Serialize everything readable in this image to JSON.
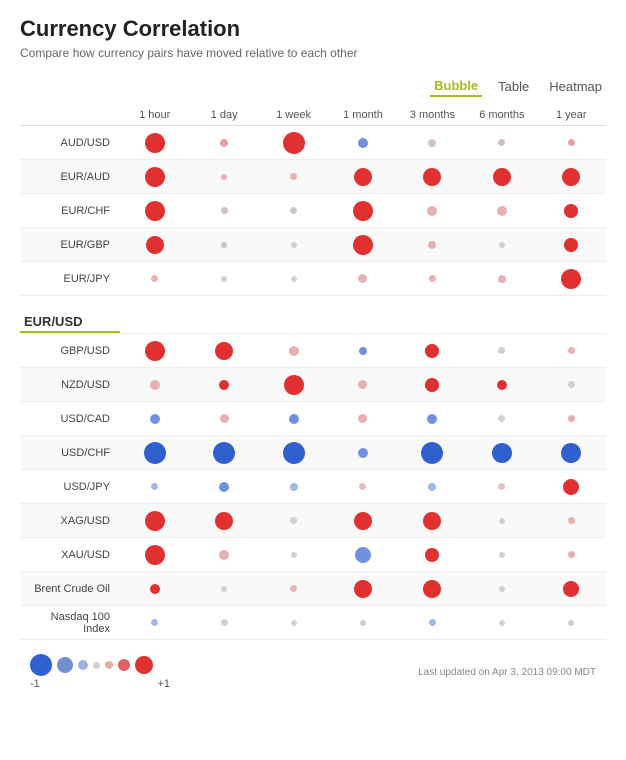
{
  "title": "Currency Correlation",
  "subtitle": "Compare how currency pairs have moved relative to each other",
  "viewToggle": {
    "options": [
      "Bubble",
      "Table",
      "Heatmap"
    ],
    "active": "Bubble"
  },
  "columns": [
    "1 hour",
    "1 day",
    "1 week",
    "1 month",
    "3 months",
    "6 months",
    "1 year"
  ],
  "rows": [
    {
      "pair": "AUD/USD",
      "highlighted": false,
      "separator": false,
      "values": [
        {
          "size": 20,
          "color": "#e03030"
        },
        {
          "size": 8,
          "color": "#e8a0a0"
        },
        {
          "size": 22,
          "color": "#e03030"
        },
        {
          "size": 10,
          "color": "#7090e0"
        },
        {
          "size": 8,
          "color": "#d0c0c0"
        },
        {
          "size": 7,
          "color": "#d0c0c0"
        },
        {
          "size": 7,
          "color": "#e8a0a0"
        }
      ]
    },
    {
      "pair": "EUR/AUD",
      "highlighted": false,
      "separator": false,
      "values": [
        {
          "size": 20,
          "color": "#e03030"
        },
        {
          "size": 6,
          "color": "#e8b0b0"
        },
        {
          "size": 7,
          "color": "#e8b0b0"
        },
        {
          "size": 18,
          "color": "#e03030"
        },
        {
          "size": 18,
          "color": "#e03030"
        },
        {
          "size": 18,
          "color": "#e03030"
        },
        {
          "size": 18,
          "color": "#e03030"
        }
      ]
    },
    {
      "pair": "EUR/CHF",
      "highlighted": false,
      "separator": false,
      "values": [
        {
          "size": 20,
          "color": "#e03030"
        },
        {
          "size": 7,
          "color": "#d0c0c0"
        },
        {
          "size": 7,
          "color": "#c8c8c8"
        },
        {
          "size": 20,
          "color": "#e03030"
        },
        {
          "size": 10,
          "color": "#e8b0b0"
        },
        {
          "size": 10,
          "color": "#e8b0b0"
        },
        {
          "size": 14,
          "color": "#e03030"
        }
      ]
    },
    {
      "pair": "EUR/GBP",
      "highlighted": false,
      "separator": false,
      "values": [
        {
          "size": 18,
          "color": "#e03030"
        },
        {
          "size": 6,
          "color": "#d0c0c0"
        },
        {
          "size": 6,
          "color": "#d0d0d0"
        },
        {
          "size": 20,
          "color": "#e03030"
        },
        {
          "size": 8,
          "color": "#e8b0b0"
        },
        {
          "size": 6,
          "color": "#d0d0d0"
        },
        {
          "size": 14,
          "color": "#e03030"
        }
      ]
    },
    {
      "pair": "EUR/JPY",
      "highlighted": false,
      "separator": false,
      "values": [
        {
          "size": 7,
          "color": "#e8b0b0"
        },
        {
          "size": 6,
          "color": "#d0d0d0"
        },
        {
          "size": 6,
          "color": "#d0d0d0"
        },
        {
          "size": 9,
          "color": "#e8b0b0"
        },
        {
          "size": 7,
          "color": "#e8b0b0"
        },
        {
          "size": 8,
          "color": "#e8b0b0"
        },
        {
          "size": 20,
          "color": "#e03030"
        }
      ]
    },
    {
      "pair": "EUR/USD",
      "highlighted": true,
      "separator": true,
      "values": []
    },
    {
      "pair": "GBP/USD",
      "highlighted": false,
      "separator": false,
      "values": [
        {
          "size": 20,
          "color": "#e03030"
        },
        {
          "size": 18,
          "color": "#e03030"
        },
        {
          "size": 10,
          "color": "#e8b0b0"
        },
        {
          "size": 8,
          "color": "#7090e0"
        },
        {
          "size": 14,
          "color": "#e03030"
        },
        {
          "size": 7,
          "color": "#d0d0d0"
        },
        {
          "size": 7,
          "color": "#e8b0b0"
        }
      ]
    },
    {
      "pair": "NZD/USD",
      "highlighted": false,
      "separator": false,
      "values": [
        {
          "size": 10,
          "color": "#e8b0b0"
        },
        {
          "size": 10,
          "color": "#e03030"
        },
        {
          "size": 20,
          "color": "#e03030"
        },
        {
          "size": 9,
          "color": "#e8b0b0"
        },
        {
          "size": 14,
          "color": "#e03030"
        },
        {
          "size": 10,
          "color": "#e03030"
        },
        {
          "size": 7,
          "color": "#d0d0d0"
        }
      ]
    },
    {
      "pair": "USD/CAD",
      "highlighted": false,
      "separator": false,
      "values": [
        {
          "size": 10,
          "color": "#7090e0"
        },
        {
          "size": 9,
          "color": "#e8b0b0"
        },
        {
          "size": 10,
          "color": "#7090e0"
        },
        {
          "size": 9,
          "color": "#e8b0b0"
        },
        {
          "size": 10,
          "color": "#7090e0"
        },
        {
          "size": 7,
          "color": "#d0d0d0"
        },
        {
          "size": 7,
          "color": "#e8b0b0"
        }
      ]
    },
    {
      "pair": "USD/CHF",
      "highlighted": false,
      "separator": false,
      "values": [
        {
          "size": 22,
          "color": "#3060d0"
        },
        {
          "size": 22,
          "color": "#3060d0"
        },
        {
          "size": 22,
          "color": "#3060d0"
        },
        {
          "size": 10,
          "color": "#7090e0"
        },
        {
          "size": 22,
          "color": "#3060d0"
        },
        {
          "size": 20,
          "color": "#3060d0"
        },
        {
          "size": 20,
          "color": "#3060d0"
        }
      ]
    },
    {
      "pair": "USD/JPY",
      "highlighted": false,
      "separator": false,
      "values": [
        {
          "size": 7,
          "color": "#a0b8e8"
        },
        {
          "size": 10,
          "color": "#7090e0"
        },
        {
          "size": 8,
          "color": "#a0b8e8"
        },
        {
          "size": 7,
          "color": "#e8b8b8"
        },
        {
          "size": 8,
          "color": "#a0b8e8"
        },
        {
          "size": 7,
          "color": "#e8c0c0"
        },
        {
          "size": 16,
          "color": "#e03030"
        }
      ]
    },
    {
      "pair": "XAG/USD",
      "highlighted": false,
      "separator": false,
      "values": [
        {
          "size": 20,
          "color": "#e03030"
        },
        {
          "size": 18,
          "color": "#e03030"
        },
        {
          "size": 7,
          "color": "#d0d0d0"
        },
        {
          "size": 18,
          "color": "#e03030"
        },
        {
          "size": 18,
          "color": "#e03030"
        },
        {
          "size": 6,
          "color": "#d0d0d0"
        },
        {
          "size": 7,
          "color": "#e8b0b0"
        }
      ]
    },
    {
      "pair": "XAU/USD",
      "highlighted": false,
      "separator": false,
      "values": [
        {
          "size": 20,
          "color": "#e03030"
        },
        {
          "size": 10,
          "color": "#e8b0b0"
        },
        {
          "size": 6,
          "color": "#d0d0d0"
        },
        {
          "size": 16,
          "color": "#7090e0"
        },
        {
          "size": 14,
          "color": "#e03030"
        },
        {
          "size": 6,
          "color": "#d0d0d0"
        },
        {
          "size": 7,
          "color": "#e8b0b0"
        }
      ]
    },
    {
      "pair": "Brent Crude Oil",
      "highlighted": false,
      "separator": false,
      "values": [
        {
          "size": 10,
          "color": "#e03030"
        },
        {
          "size": 6,
          "color": "#d0d0d0"
        },
        {
          "size": 7,
          "color": "#e8b8b8"
        },
        {
          "size": 18,
          "color": "#e03030"
        },
        {
          "size": 18,
          "color": "#e03030"
        },
        {
          "size": 6,
          "color": "#d0d0d0"
        },
        {
          "size": 16,
          "color": "#e03030"
        }
      ]
    },
    {
      "pair": "Nasdaq 100\nIndex",
      "highlighted": false,
      "separator": false,
      "values": [
        {
          "size": 7,
          "color": "#a0b8e8"
        },
        {
          "size": 7,
          "color": "#d0d0d0"
        },
        {
          "size": 6,
          "color": "#d0d0d0"
        },
        {
          "size": 6,
          "color": "#d0d0d0"
        },
        {
          "size": 7,
          "color": "#a0b8e8"
        },
        {
          "size": 6,
          "color": "#d0d0d0"
        },
        {
          "size": 6,
          "color": "#d0d0d0"
        }
      ]
    }
  ],
  "legend": {
    "bubbles": [
      {
        "size": 22,
        "color": "#3060d0"
      },
      {
        "size": 16,
        "color": "#7090d0"
      },
      {
        "size": 10,
        "color": "#a0b0e0"
      },
      {
        "size": 7,
        "color": "#d0d0d0"
      },
      {
        "size": 8,
        "color": "#e8b0a0"
      },
      {
        "size": 12,
        "color": "#e06060"
      },
      {
        "size": 18,
        "color": "#e03030"
      }
    ],
    "minLabel": "-1",
    "maxLabel": "+1"
  },
  "lastUpdated": "Last updated on Apr 3, 2013 09:00 MDT"
}
